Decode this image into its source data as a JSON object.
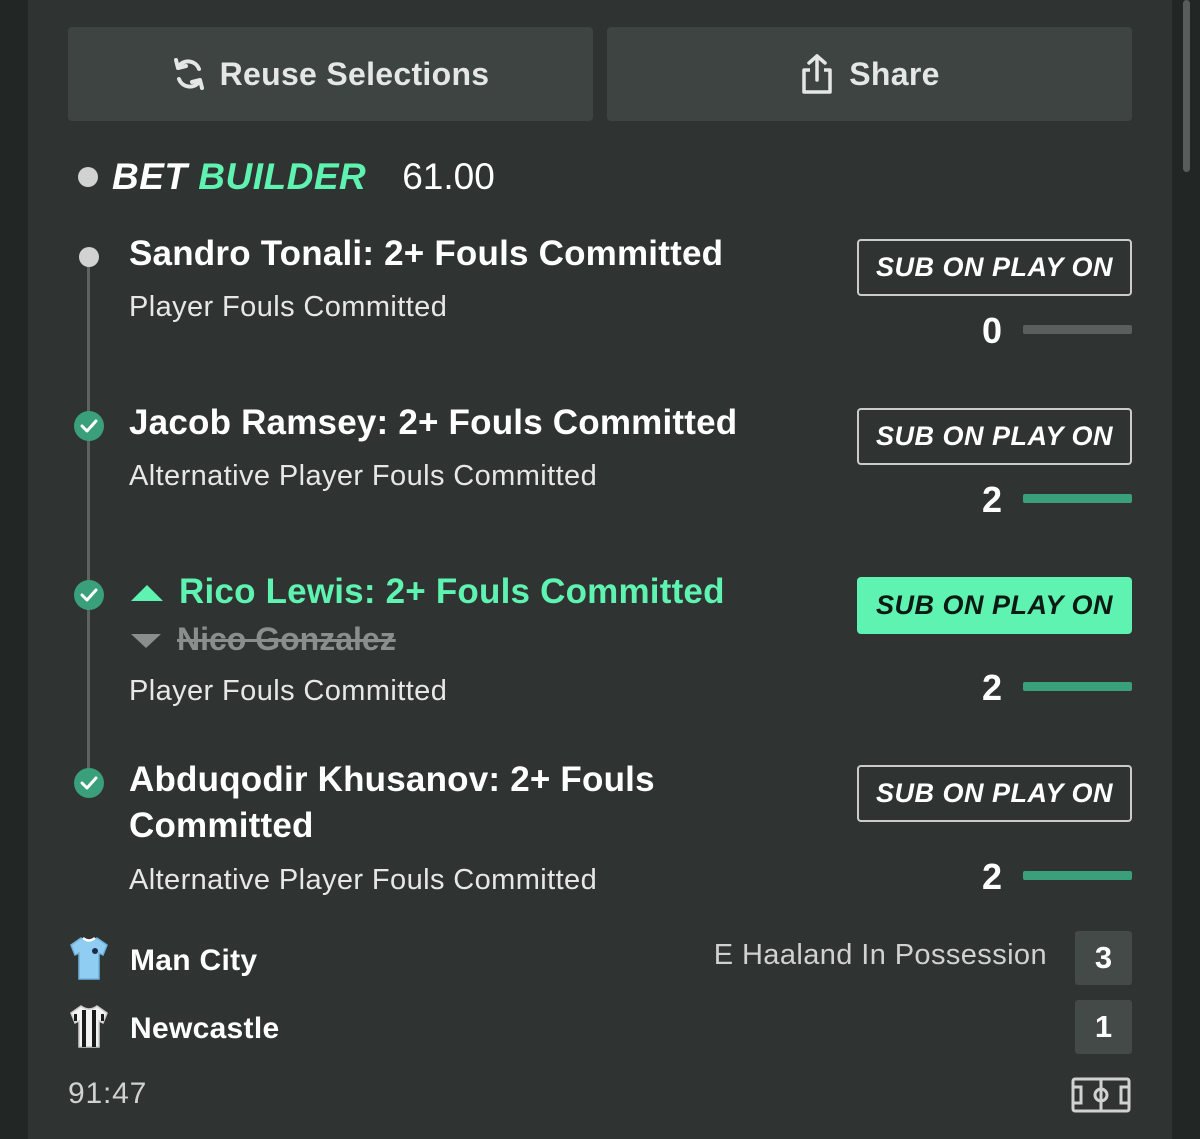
{
  "actions": {
    "reuse_label": "Reuse Selections",
    "share_label": "Share"
  },
  "bet": {
    "brand_white": "BET",
    "brand_green": "BUILDER",
    "odds": "61.00"
  },
  "selections": [
    {
      "title": "Sandro Tonali: 2+ Fouls Committed",
      "market": "Player Fouls Committed",
      "status": "pending",
      "button": "SUB ON PLAY ON",
      "button_active": false,
      "count": "0",
      "progress": 0
    },
    {
      "title": "Jacob Ramsey: 2+ Fouls Committed",
      "market": "Alternative Player Fouls Committed",
      "status": "won",
      "button": "SUB ON PLAY ON",
      "button_active": false,
      "count": "2",
      "progress": 1
    },
    {
      "title": "Rico Lewis: 2+ Fouls Committed",
      "subbed_out": "Nico Gonzalez",
      "market": "Player Fouls Committed",
      "status": "won",
      "button": "SUB ON PLAY ON",
      "button_active": true,
      "count": "2",
      "progress": 1
    },
    {
      "title_line1": "Abduqodir Khusanov: 2+ Fouls",
      "title_line2": "Committed",
      "market": "Alternative Player Fouls Committed",
      "status": "won",
      "button": "SUB ON PLAY ON",
      "button_active": false,
      "count": "2",
      "progress": 1
    }
  ],
  "match": {
    "home": {
      "name": "Man City",
      "score": "3"
    },
    "away": {
      "name": "Newcastle",
      "score": "1"
    },
    "possession_text": "E Haaland In Possession",
    "clock": "91:47"
  },
  "colors": {
    "accent": "#5ef3b0",
    "check": "#3a9f7b",
    "panel": "#2f3432"
  }
}
